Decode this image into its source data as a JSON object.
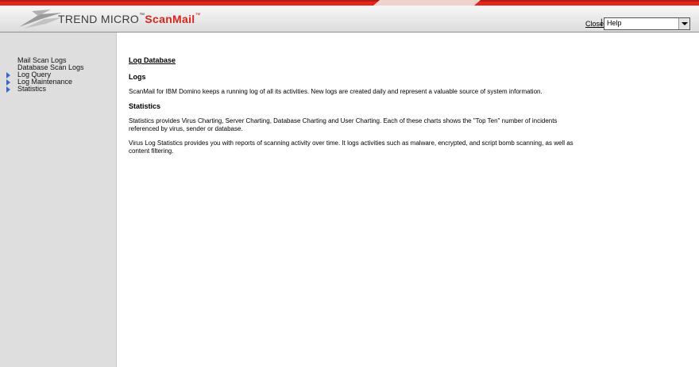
{
  "header": {
    "brand_trend": "TREND MICRO",
    "brand_tm": "™",
    "brand_product": "ScanMail",
    "brand_product_tm": "™",
    "close_label": "Close",
    "separator": "|",
    "help_select": {
      "selected": "Help"
    }
  },
  "sidebar": {
    "items": [
      {
        "label": "Mail Scan Logs",
        "expandable": false
      },
      {
        "label": "Database Scan Logs",
        "expandable": false
      },
      {
        "label": "Log Query",
        "expandable": true
      },
      {
        "label": "Log Maintenance",
        "expandable": true
      },
      {
        "label": "Statistics",
        "expandable": true
      }
    ]
  },
  "content": {
    "title": "Log Database",
    "sections": [
      {
        "heading": "Logs",
        "paragraphs": [
          "ScanMail for IBM Domino keeps a running log of all its activities. New logs are created daily and represent a valuable source of system information."
        ]
      },
      {
        "heading": "Statistics",
        "paragraphs": [
          "Statistics provides Virus Charting, Server Charting, Database Charting and User Charting. Each of these charts shows the \"Top Ten\" number of incidents referenced by virus, sender or database.",
          "Virus Log Statistics provides you with reports of scanning activity over time. It logs activities such as malware, encrypted, and script bomb scanning, as well as content filtering."
        ]
      }
    ]
  },
  "colors": {
    "brand_red": "#d7261b",
    "top_strip": "#e3261c",
    "sidebar_bg": "#dedede",
    "nav_arrow": "#3a66c4"
  },
  "icons": {
    "logo": "trend-micro-swoosh-logo",
    "nav_expand": "blue-triangle-arrow",
    "dropdown": "chevron-down"
  }
}
